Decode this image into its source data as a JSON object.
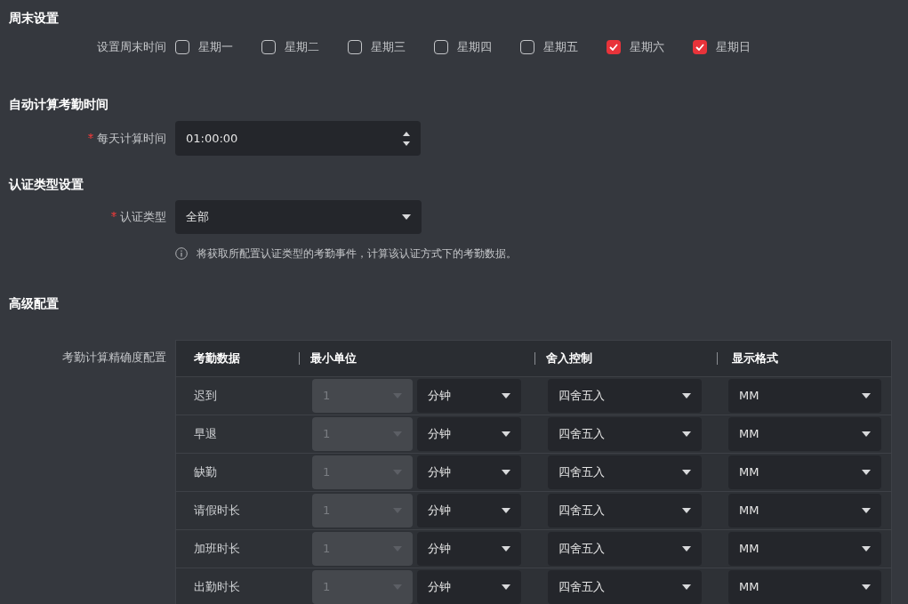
{
  "weekend": {
    "heading": "周末设置",
    "label": "设置周末时间",
    "days": [
      {
        "label": "星期一",
        "checked": false
      },
      {
        "label": "星期二",
        "checked": false
      },
      {
        "label": "星期三",
        "checked": false
      },
      {
        "label": "星期四",
        "checked": false
      },
      {
        "label": "星期五",
        "checked": false
      },
      {
        "label": "星期六",
        "checked": true
      },
      {
        "label": "星期日",
        "checked": true
      }
    ]
  },
  "auto_calc": {
    "heading": "自动计算考勤时间",
    "label": "每天计算时间",
    "required": true,
    "value": "01:00:00"
  },
  "auth": {
    "heading": "认证类型设置",
    "label": "认证类型",
    "required": true,
    "value": "全部",
    "note": "将获取所配置认证类型的考勤事件，计算该认证方式下的考勤数据。"
  },
  "advanced": {
    "heading": "高级配置",
    "label": "考勤计算精确度配置",
    "table": {
      "columns": [
        "考勤数据",
        "最小单位",
        "舍入控制",
        "显示格式"
      ],
      "rows": [
        {
          "name": "迟到",
          "min_value": "1",
          "min_disabled": true,
          "unit": "分钟",
          "rounding": "四舍五入",
          "format": "MM"
        },
        {
          "name": "早退",
          "min_value": "1",
          "min_disabled": true,
          "unit": "分钟",
          "rounding": "四舍五入",
          "format": "MM"
        },
        {
          "name": "缺勤",
          "min_value": "1",
          "min_disabled": true,
          "unit": "分钟",
          "rounding": "四舍五入",
          "format": "MM"
        },
        {
          "name": "请假时长",
          "min_value": "1",
          "min_disabled": true,
          "unit": "分钟",
          "rounding": "四舍五入",
          "format": "MM"
        },
        {
          "name": "加班时长",
          "min_value": "1",
          "min_disabled": true,
          "unit": "分钟",
          "rounding": "四舍五入",
          "format": "MM"
        },
        {
          "name": "出勤时长",
          "min_value": "1",
          "min_disabled": true,
          "unit": "分钟",
          "rounding": "四舍五入",
          "format": "MM"
        }
      ]
    }
  }
}
